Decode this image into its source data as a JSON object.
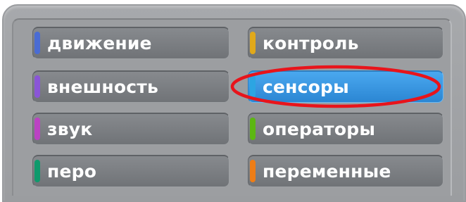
{
  "categories": {
    "motion": {
      "label": "движение",
      "color": "#4a6cd4"
    },
    "looks": {
      "label": "внешность",
      "color": "#8a55d7"
    },
    "sound": {
      "label": "звук",
      "color": "#bb42c3"
    },
    "pen": {
      "label": "перо",
      "color": "#0e9a6c"
    },
    "control": {
      "label": "контроль",
      "color": "#e1a91a"
    },
    "sensing": {
      "label": "сенсоры",
      "color": "#2ca5e2",
      "selected": true
    },
    "operators": {
      "label": "операторы",
      "color": "#5cb712"
    },
    "variables": {
      "label": "переменные",
      "color": "#ee7d16"
    }
  },
  "annotation": {
    "color": "#e8141b",
    "target": "sensing"
  },
  "colors": {
    "panel": "#a7a9ac",
    "button": "#7c7f83",
    "selected_button": "#3a97e0"
  }
}
